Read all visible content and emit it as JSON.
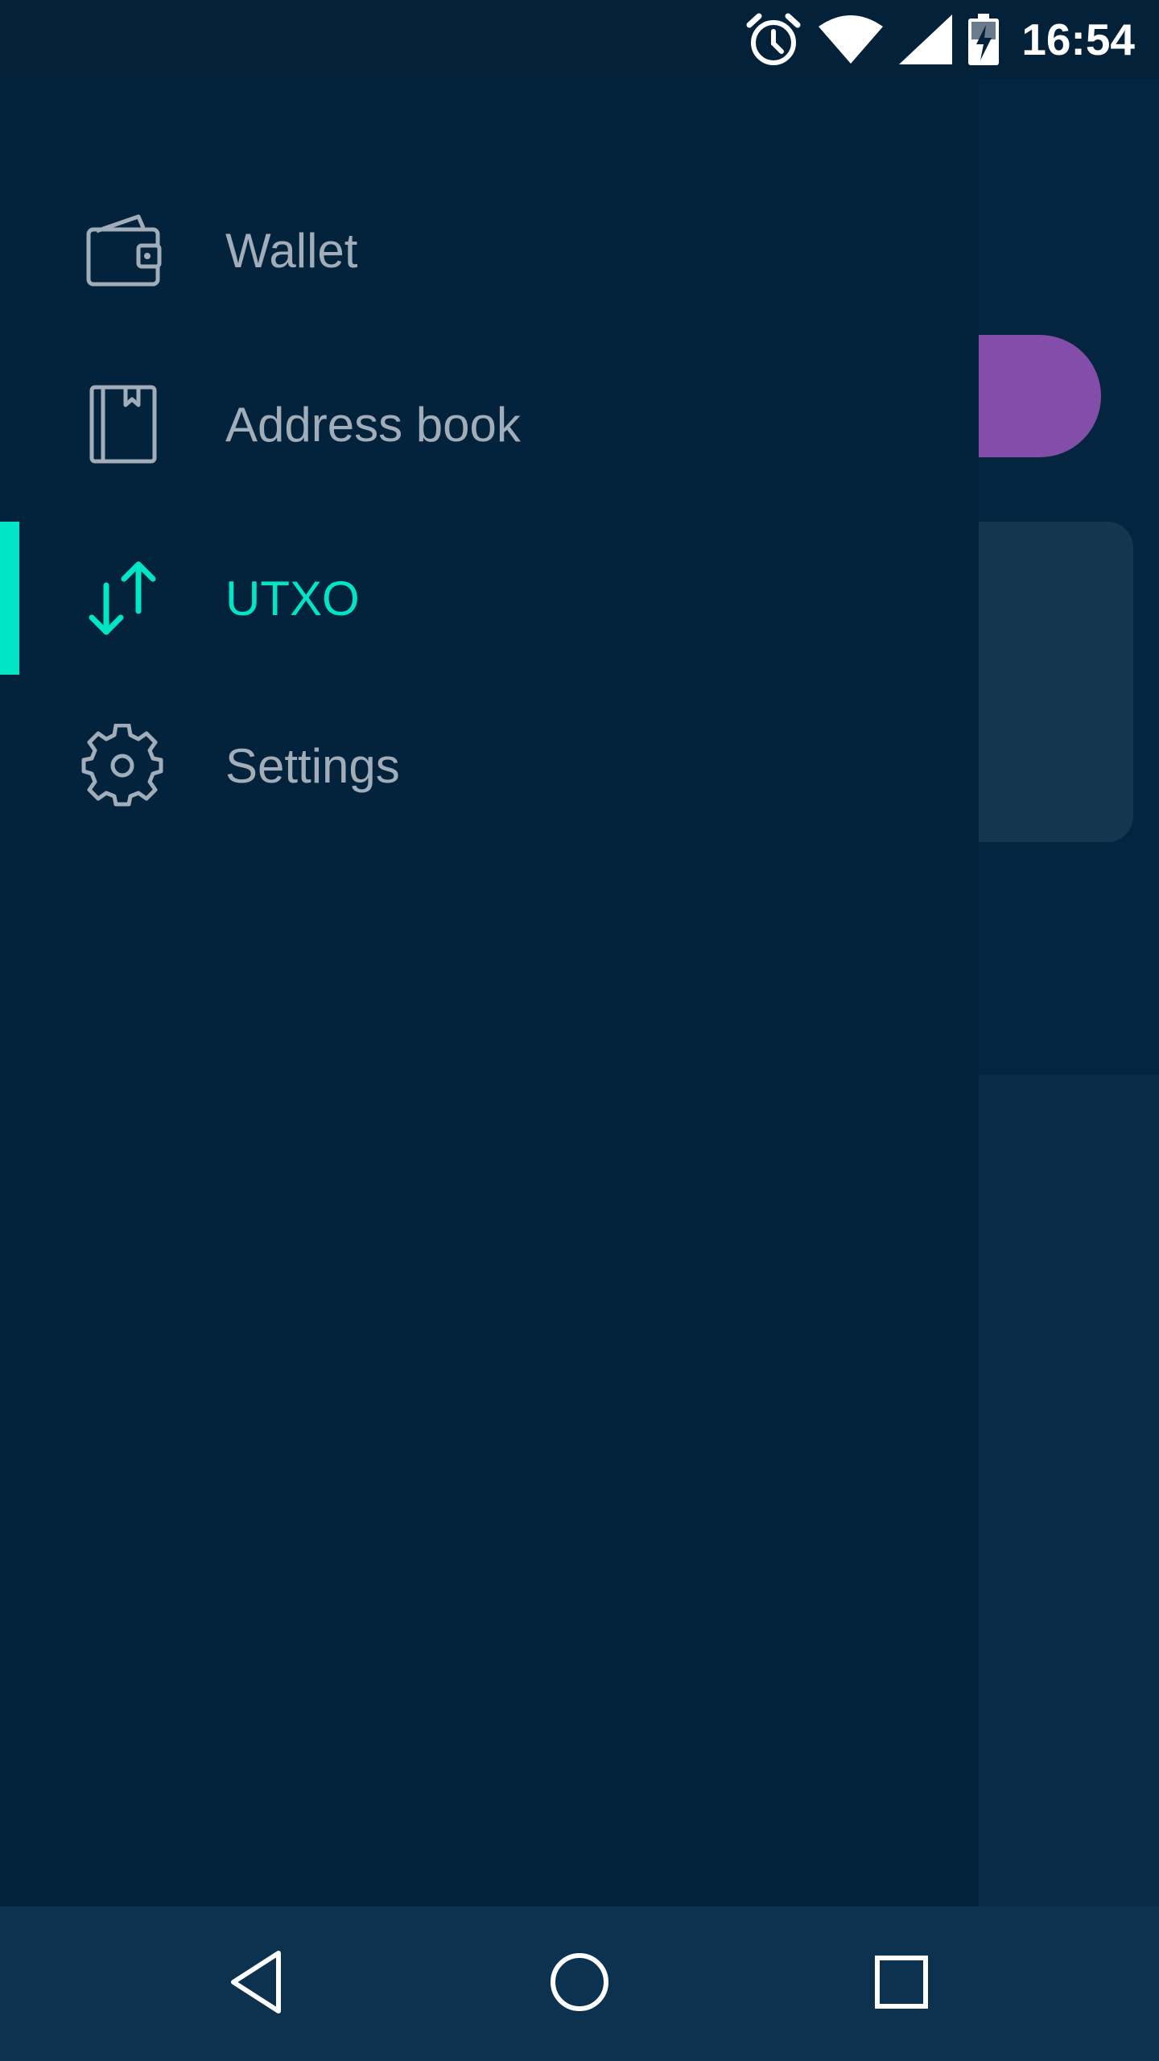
{
  "status_bar": {
    "time": "16:54",
    "icons": [
      "alarm-icon",
      "wifi-icon",
      "cellular-signal-icon",
      "battery-charging-icon"
    ]
  },
  "drawer": {
    "items": [
      {
        "label": "Wallet",
        "icon": "wallet-icon",
        "active": false
      },
      {
        "label": "Address book",
        "icon": "address-book-icon",
        "active": false
      },
      {
        "label": "UTXO",
        "icon": "transfer-arrows-icon",
        "active": true
      },
      {
        "label": "Settings",
        "icon": "gear-icon",
        "active": false
      }
    ]
  },
  "navigation_bar": {
    "buttons": [
      "back-icon",
      "home-icon",
      "recents-icon"
    ]
  },
  "colors": {
    "background": "#042540",
    "drawer": "#03233c",
    "accent": "#00e5c6",
    "inactive_text": "#a1adb8",
    "purple_pill": "#824eaa",
    "nav_bar": "#0c3250"
  }
}
